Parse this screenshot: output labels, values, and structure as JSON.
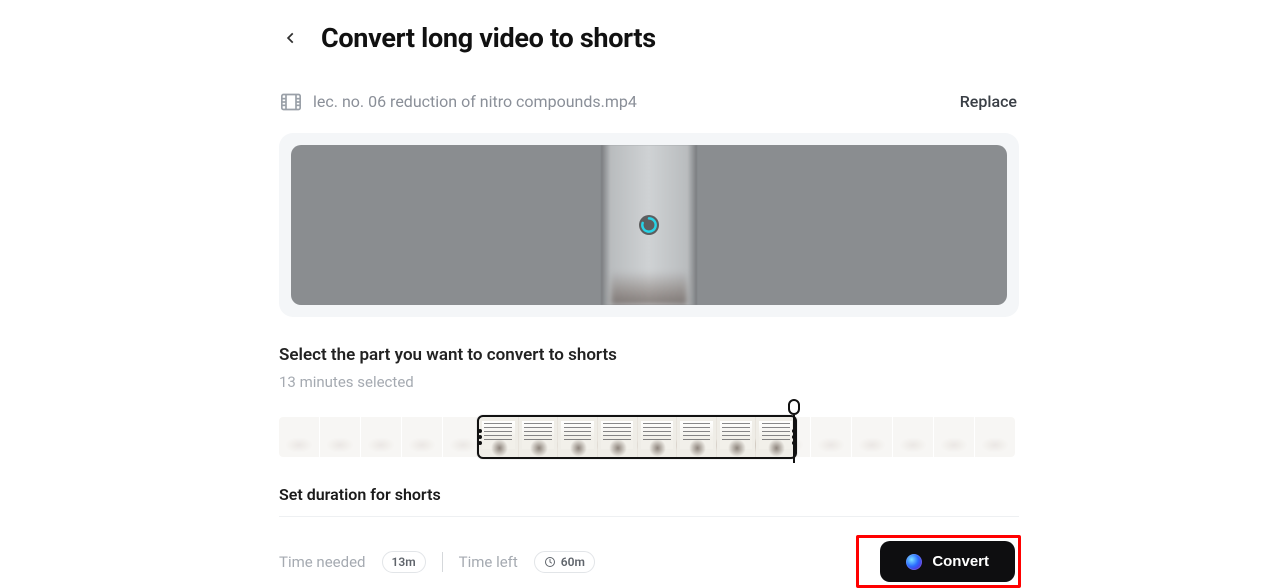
{
  "header": {
    "title": "Convert long video to shorts"
  },
  "file": {
    "name": "lec. no. 06 reduction of nitro compounds.mp4",
    "replace_label": "Replace"
  },
  "select": {
    "heading": "Select the part you want to convert to shorts",
    "selected_text": "13 minutes selected"
  },
  "duration": {
    "heading": "Set duration for shorts"
  },
  "footer": {
    "time_needed_label": "Time needed",
    "time_needed_value": "13m",
    "time_left_label": "Time left",
    "time_left_value": "60m",
    "convert_label": "Convert"
  },
  "colors": {
    "spinner": "#27d3e6",
    "highlight_box": "#ff0000",
    "button_bg": "#0e0e10"
  }
}
